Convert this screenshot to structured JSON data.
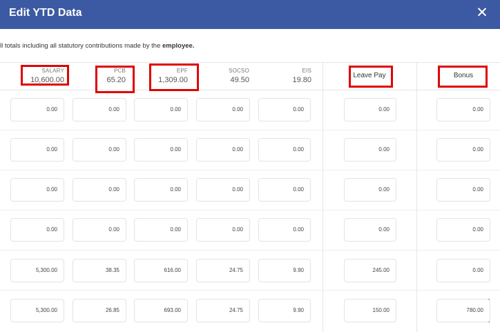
{
  "dialog": {
    "title": "Edit YTD Data",
    "close_symbol": "✕",
    "subtitle_prefix": "ll totals including all statutory contributions made by the ",
    "subtitle_bold": "employee."
  },
  "columns": [
    {
      "label": "SALARY",
      "total": "10,600.00"
    },
    {
      "label": "PCB",
      "total": "65.20"
    },
    {
      "label": "EPF",
      "total": "1,309.00"
    },
    {
      "label": "SOCSO",
      "total": "49.50"
    },
    {
      "label": "EIS",
      "total": "19.80"
    },
    {
      "label": "Leave Pay"
    },
    {
      "label": "Bonus"
    }
  ],
  "rows": [
    [
      "0.00",
      "0.00",
      "0.00",
      "0.00",
      "0.00",
      "0.00",
      "0.00"
    ],
    [
      "0.00",
      "0.00",
      "0.00",
      "0.00",
      "0.00",
      "0.00",
      "0.00"
    ],
    [
      "0.00",
      "0.00",
      "0.00",
      "0.00",
      "0.00",
      "0.00",
      "0.00"
    ],
    [
      "0.00",
      "0.00",
      "0.00",
      "0.00",
      "0.00",
      "0.00",
      "0.00"
    ],
    [
      "5,300.00",
      "38.35",
      "616.00",
      "24.75",
      "9.90",
      "245.00",
      "0.00"
    ],
    [
      "5,300.00",
      "26.85",
      "693.00",
      "24.75",
      "9.90",
      "150.00",
      "780.00"
    ]
  ],
  "highlight_color": "#e00000",
  "header_color": "#3b5aa3"
}
